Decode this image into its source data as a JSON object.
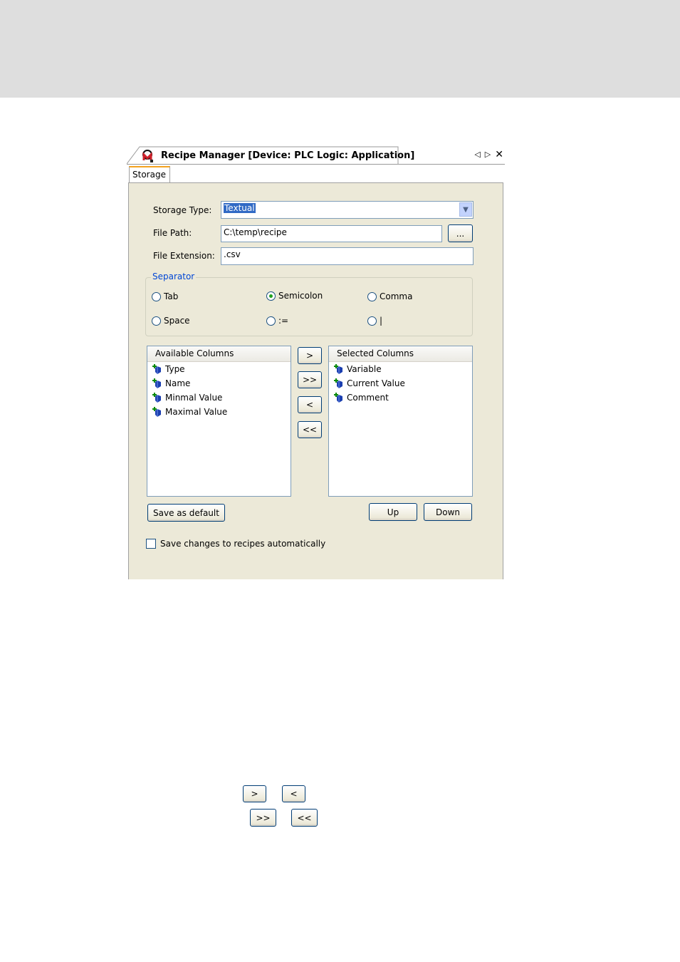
{
  "window": {
    "title": "Recipe Manager [Device: PLC Logic: Application]",
    "tab_label": "Storage"
  },
  "form": {
    "storage_type_label": "Storage Type:",
    "storage_type_value": "Textual",
    "file_path_label": "File Path:",
    "file_path_value": "C:\\temp\\recipe",
    "browse_label": "...",
    "file_extension_label": "File Extension:",
    "file_extension_value": ".csv"
  },
  "separator": {
    "title": "Separator",
    "options": [
      {
        "label": "Tab",
        "selected": false
      },
      {
        "label": "Semicolon",
        "selected": true
      },
      {
        "label": "Comma",
        "selected": false
      },
      {
        "label": "Space",
        "selected": false
      },
      {
        "label": ":=",
        "selected": false
      },
      {
        "label": "|",
        "selected": false
      }
    ]
  },
  "available_columns": {
    "header": "Available Columns",
    "items": [
      "Type",
      "Name",
      "Minmal Value",
      "Maximal Value"
    ]
  },
  "selected_columns": {
    "header": "Selected Columns",
    "items": [
      "Variable",
      "Current Value",
      "Comment"
    ]
  },
  "move_buttons": {
    "add": ">",
    "add_all": ">>",
    "remove": "<",
    "remove_all": "<<"
  },
  "buttons": {
    "save_default": "Save as default",
    "up": "Up",
    "down": "Down"
  },
  "auto_save": {
    "label": "Save changes to recipes automatically",
    "checked": false
  },
  "legend_buttons": {
    "add": ">",
    "remove": "<",
    "add_all": ">>",
    "remove_all": "<<"
  },
  "colors": {
    "panel_bg": "#ece9d8",
    "header_band": "#dedede",
    "tab_accent": "#f4a21f",
    "group_title": "#0046d5"
  },
  "icons": [
    "recipe-manager-icon",
    "nav-left-icon",
    "nav-right-icon",
    "close-icon",
    "dropdown-arrow-icon",
    "column-item-icon"
  ]
}
